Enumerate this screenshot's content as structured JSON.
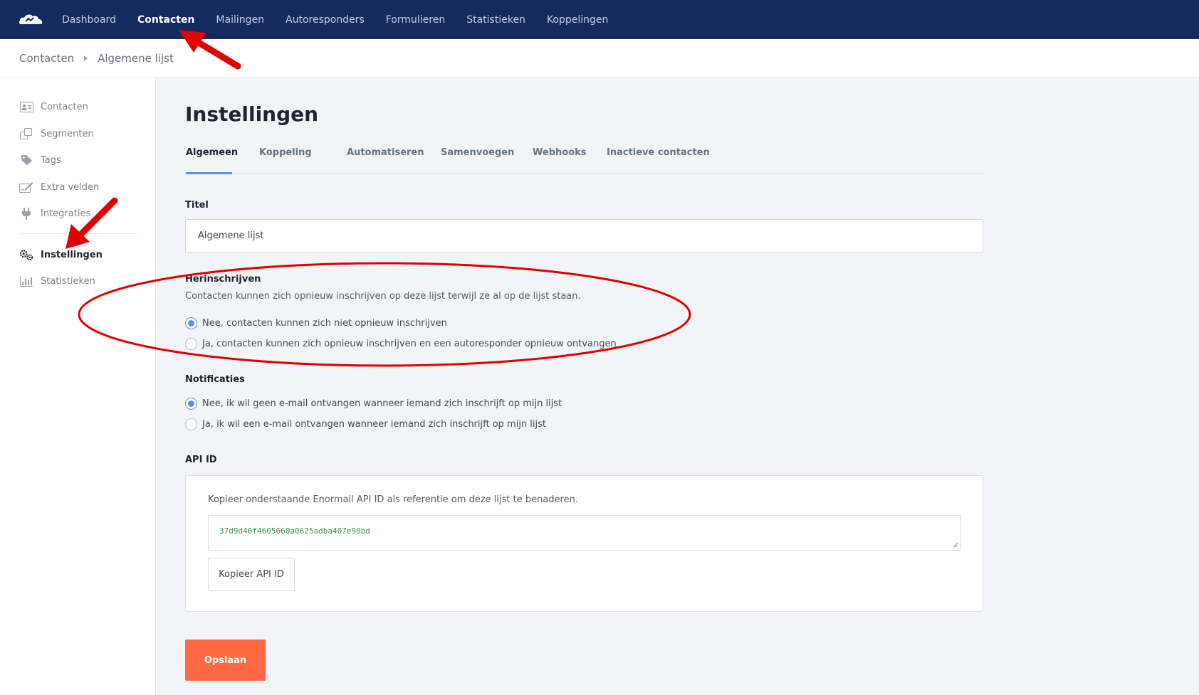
{
  "colors": {
    "nav_background": "#152a5e",
    "accent": "#5b93d8",
    "primary_button": "#ff6a45",
    "annotation": "#e00000"
  },
  "topnav": {
    "logo_icon": "cloud-logo-icon",
    "links": [
      {
        "label": "Dashboard",
        "active": false
      },
      {
        "label": "Contacten",
        "active": true
      },
      {
        "label": "Mailingen",
        "active": false
      },
      {
        "label": "Autoresponders",
        "active": false
      },
      {
        "label": "Formulieren",
        "active": false
      },
      {
        "label": "Statistieken",
        "active": false
      },
      {
        "label": "Koppelingen",
        "active": false
      }
    ]
  },
  "breadcrumb": {
    "items": [
      "Contacten",
      "Algemene lijst"
    ]
  },
  "sidebar": {
    "items": [
      {
        "label": "Contacten",
        "icon": "contact-card-icon"
      },
      {
        "label": "Segmenten",
        "icon": "segments-icon"
      },
      {
        "label": "Tags",
        "icon": "tag-icon"
      },
      {
        "label": "Extra velden",
        "icon": "edit-fields-icon"
      },
      {
        "label": "Integraties",
        "icon": "plug-icon"
      },
      {
        "label": "Instellingen",
        "icon": "gears-icon",
        "active": true
      },
      {
        "label": "Statistieken",
        "icon": "bar-chart-icon"
      }
    ]
  },
  "main": {
    "title": "Instellingen",
    "tabs": [
      {
        "label": "Algemeen",
        "active": true
      },
      {
        "label": "Koppeling"
      },
      {
        "label": "Automatiseren"
      },
      {
        "label": "Samenvoegen"
      },
      {
        "label": "Webhooks"
      },
      {
        "label": "Inactieve contacten"
      }
    ],
    "title_field": {
      "label": "Titel",
      "value": "Algemene lijst"
    },
    "resubscribe": {
      "label": "Herinschrijven",
      "description": "Contacten kunnen zich opnieuw inschrijven op deze lijst terwijl ze al op de lijst staan.",
      "options": [
        {
          "label": "Nee, contacten kunnen zich niet opnieuw inschrijven",
          "checked": true
        },
        {
          "label": "Ja, contacten kunnen zich opnieuw inschrijven en een autoresponder opnieuw ontvangen",
          "checked": false
        }
      ]
    },
    "notifications": {
      "label": "Notificaties",
      "options": [
        {
          "label": "Nee, ik wil geen e-mail ontvangen wanneer iemand zich inschrijft op mijn lijst",
          "checked": true
        },
        {
          "label": "Ja, ik wil een e-mail ontvangen wanneer iemand zich inschrijft op mijn lijst",
          "checked": false
        }
      ]
    },
    "api": {
      "label": "API ID",
      "description": "Kopieer onderstaande Enormail API ID als referentie om deze lijst te benaderen.",
      "api_id": "37d9d46f4605660a0625adba407e90bd",
      "copy_label": "Kopieer API ID"
    },
    "save_label": "Opslaan"
  }
}
